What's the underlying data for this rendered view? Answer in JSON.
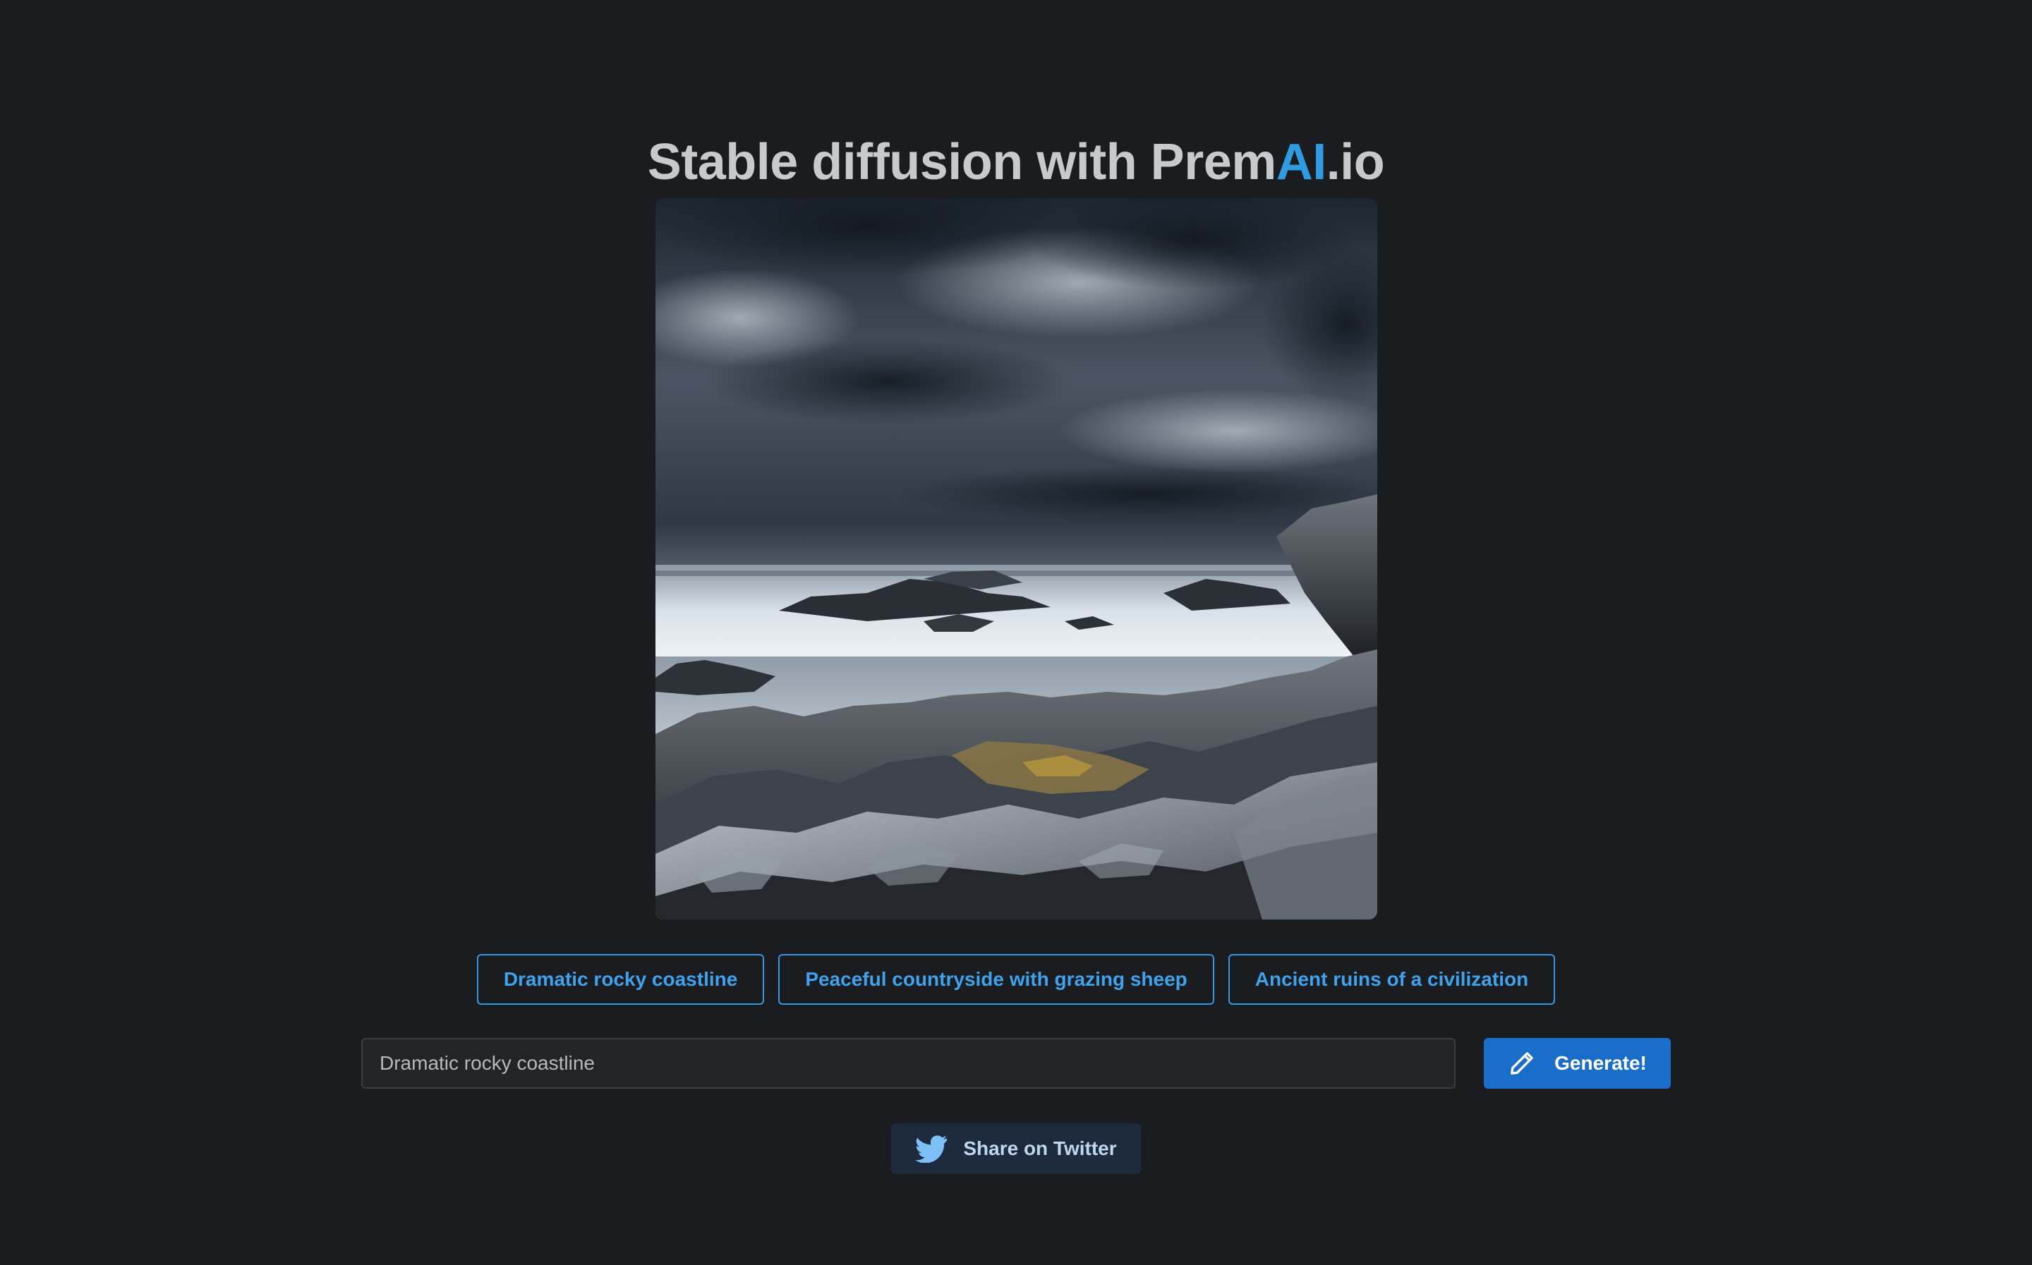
{
  "header": {
    "title_prefix": "Stable diffusion with Prem",
    "title_accent": "AI",
    "title_suffix": ".io"
  },
  "generated_image": {
    "description_tag": "rocky-coastline-image"
  },
  "suggestions": [
    {
      "label": "Dramatic rocky coastline"
    },
    {
      "label": "Peaceful countryside with grazing sheep"
    },
    {
      "label": "Ancient ruins of a civilization"
    }
  ],
  "prompt": {
    "value": "Dramatic rocky coastline"
  },
  "generate": {
    "label": "Generate!",
    "icon": "pencil-icon"
  },
  "share": {
    "label": "Share on Twitter",
    "icon": "twitter-bird-icon"
  },
  "colors": {
    "background": "#1b1c20",
    "accent": "#2f9be0",
    "primary_button": "#1a6ec9",
    "twitter_button": "#1d2a3d"
  }
}
